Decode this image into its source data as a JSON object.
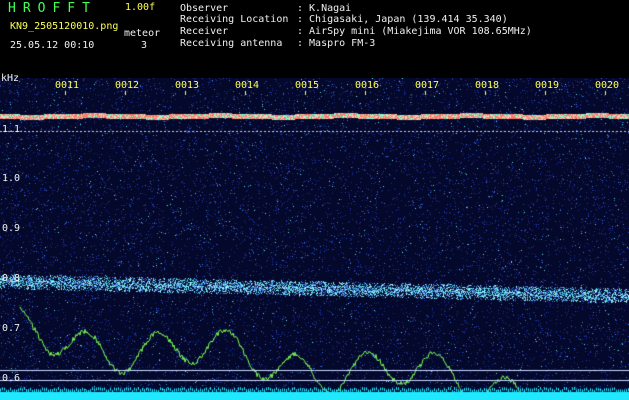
{
  "header": {
    "app_title": "HROFFT",
    "version": "1.00f",
    "filename": "KN9_2505120010.png",
    "meteor_label": "meteor",
    "datetime": "25.05.12 00:10",
    "meteor_count": "3"
  },
  "metadata": [
    {
      "key": "Observer",
      "value": ": K.Nagai"
    },
    {
      "key": "Receiving Location",
      "value": ": Chigasaki, Japan (139.414 35.340)"
    },
    {
      "key": "Receiver",
      "value": ": AirSpy mini (Miakejima VOR 108.65MHz)"
    },
    {
      "key": "Receiving antenna",
      "value": ": Maspro FM-3"
    }
  ],
  "spectrogram": {
    "y_unit": "kHz",
    "y_labels": [
      "1.1",
      "1.0",
      "0.9",
      "0.8",
      "0.7",
      "0.6"
    ],
    "x_labels": [
      "0011",
      "0012",
      "0013",
      "0014",
      "0015",
      "0016",
      "0017",
      "0018",
      "0019",
      "0020"
    ],
    "colors": {
      "background": "#04082a",
      "noise": "#2a3fb5",
      "trace": "#7cff55",
      "baseline": "#20e8ff",
      "label_yellow": "#ffff55",
      "label_green": "#41ff57"
    }
  }
}
